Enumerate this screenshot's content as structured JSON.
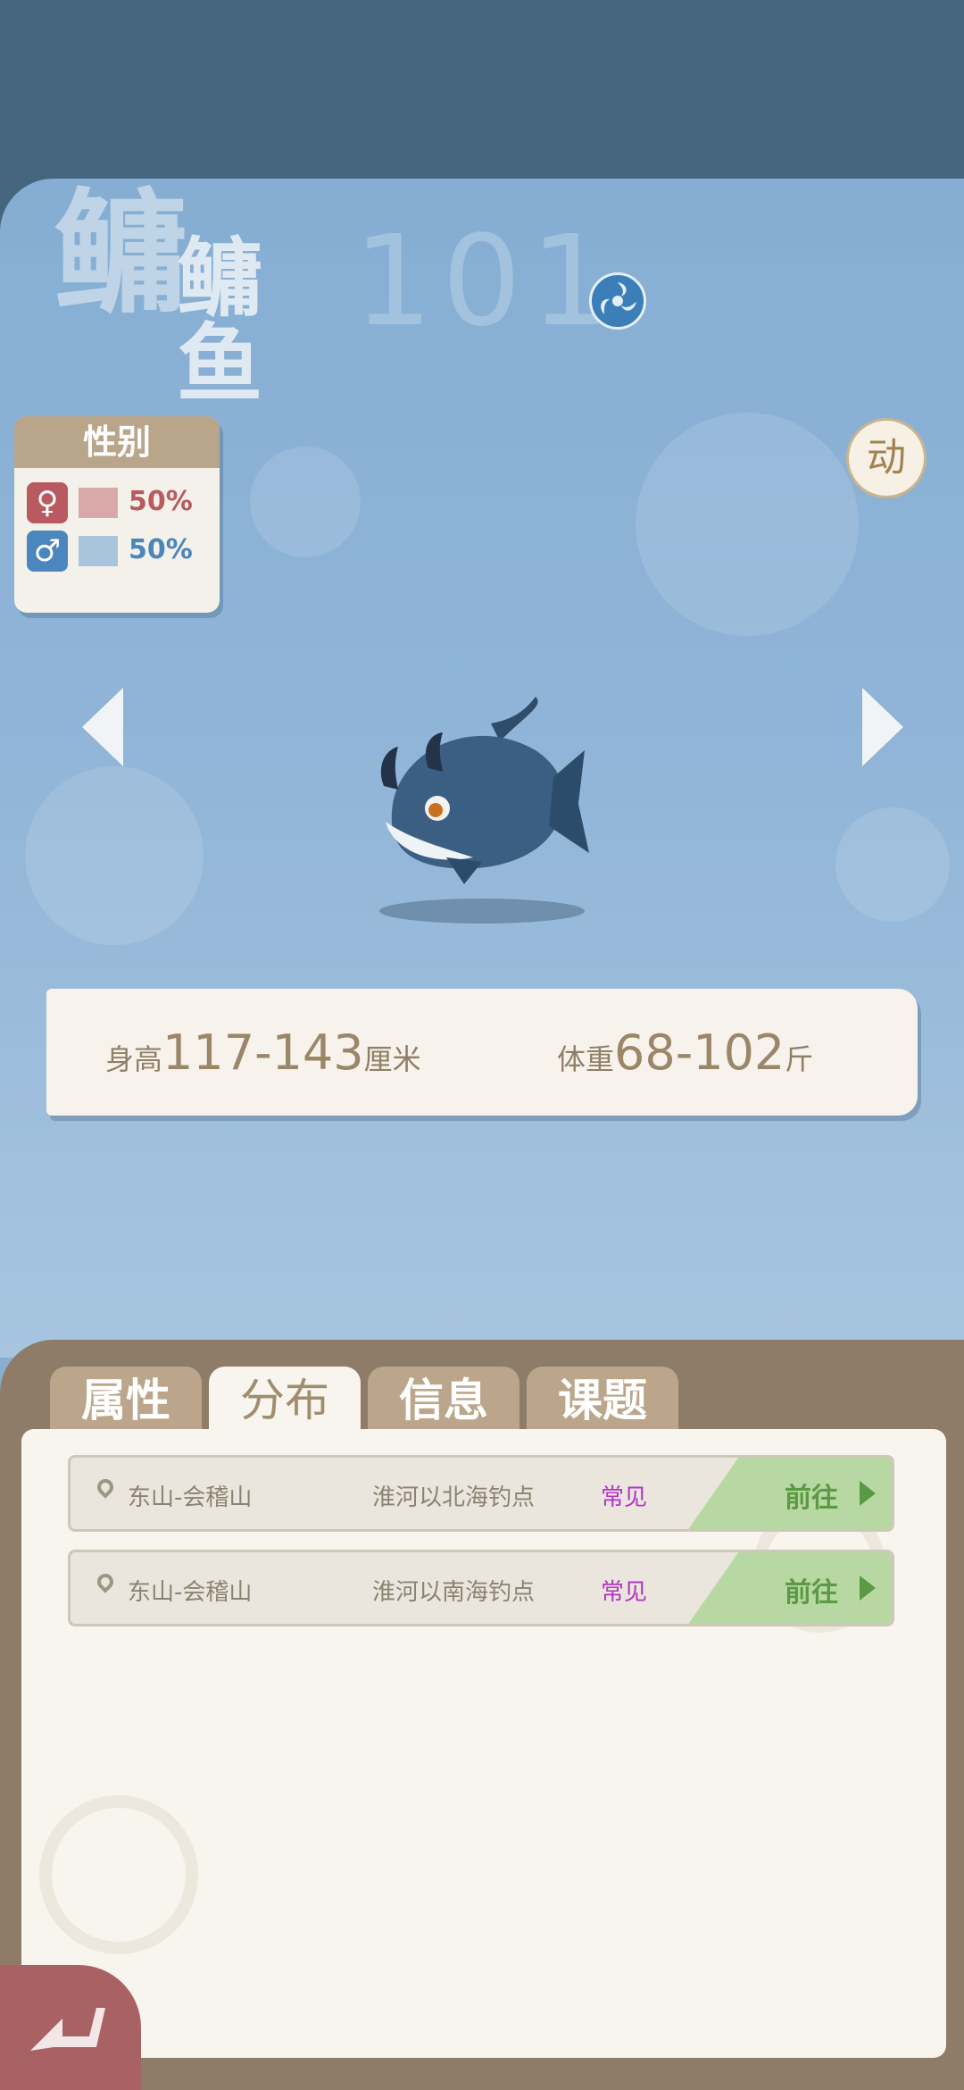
{
  "colors": {
    "header_bg": "#46667f",
    "hero_bg": "#8aaed0",
    "panel_bg": "#8e7c69",
    "card_bg": "#f8f5ee",
    "female": "#b85a5f",
    "male": "#4b86be",
    "go_green": "#5b9a44",
    "rarity": "#b235c4"
  },
  "species": {
    "big_char": "鳙",
    "name": "鳙鱼",
    "number": "101",
    "element_icon": "wind-swirl-icon"
  },
  "gender": {
    "title": "性别",
    "female_symbol": "♀",
    "female_pct": "50%",
    "male_symbol": "♂",
    "male_pct": "50%"
  },
  "animate_button": "动",
  "stats": {
    "height_label": "身高",
    "height_value": "117-143",
    "height_unit": "厘米",
    "weight_label": "体重",
    "weight_value": "68-102",
    "weight_unit": "斤"
  },
  "tabs": [
    {
      "label": "属性",
      "active": false
    },
    {
      "label": "分布",
      "active": true
    },
    {
      "label": "信息",
      "active": false
    },
    {
      "label": "课题",
      "active": false
    }
  ],
  "locations": [
    {
      "region": "东山-会稽山",
      "spot": "淮河以北海钓点",
      "rarity": "常见",
      "action": "前往"
    },
    {
      "region": "东山-会稽山",
      "spot": "淮河以南海钓点",
      "rarity": "常见",
      "action": "前往"
    }
  ]
}
